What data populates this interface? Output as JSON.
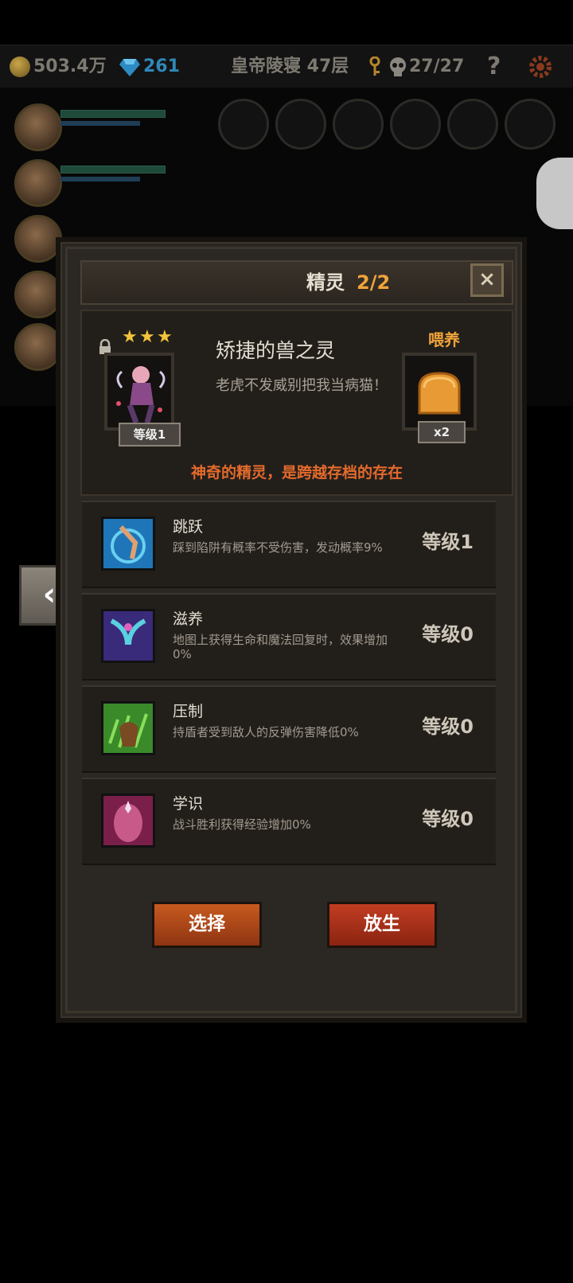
{
  "topbar": {
    "gold": "503.4万",
    "gems": "261",
    "location": "皇帝陵寝 47层",
    "kills": "27/27",
    "help": "?"
  },
  "dialog": {
    "title": "精灵",
    "count": "2/2",
    "close": "×",
    "sprite": {
      "stars": 3,
      "level": "等级1",
      "name": "矫捷的兽之灵",
      "desc": "老虎不发威别把我当病猫！",
      "feed_label": "喂养",
      "feed_qty": "x2",
      "tagline": "神奇的精灵，是跨越存档的存在"
    },
    "skills": [
      {
        "name": "跳跃",
        "desc": "踩到陷阱有概率不受伤害，发动概率9%",
        "level": "等级1"
      },
      {
        "name": "滋养",
        "desc": "地图上获得生命和魔法回复时，效果增加0%",
        "level": "等级0"
      },
      {
        "name": "压制",
        "desc": "持盾者受到敌人的反弹伤害降低0%",
        "level": "等级0"
      },
      {
        "name": "学识",
        "desc": "战斗胜利获得经验增加0%",
        "level": "等级0"
      }
    ],
    "buttons": {
      "select": "选择",
      "release": "放生"
    }
  },
  "colors": {
    "accent": "#f0a43b",
    "tagline": "#e46a2c",
    "select_btn": "#c75a1f",
    "release_btn": "#c23d22"
  },
  "icons": [
    "coin-icon",
    "gem-icon",
    "key-icon",
    "skull-icon",
    "help-icon",
    "gear-icon",
    "lock-icon",
    "bread-icon",
    "left-arrow-icon"
  ]
}
